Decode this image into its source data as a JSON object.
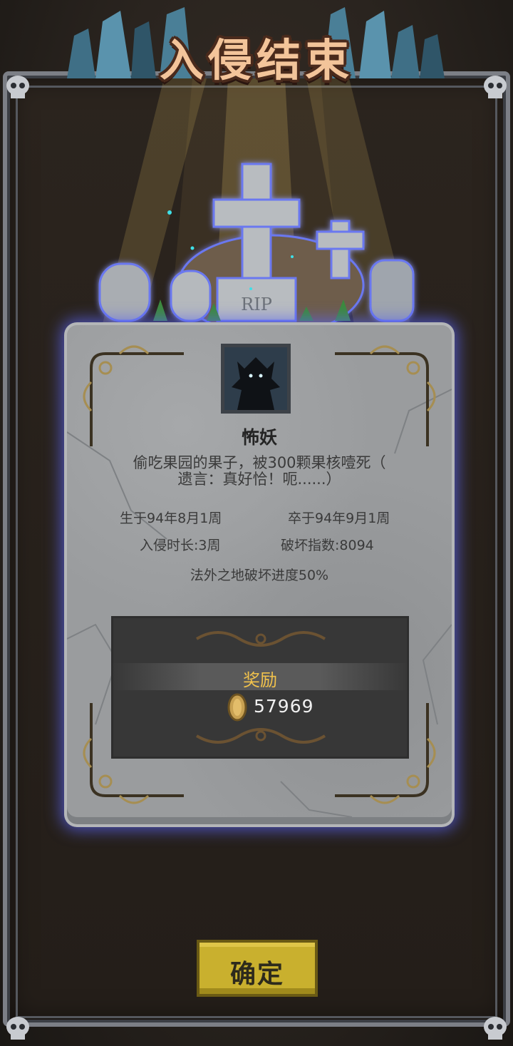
{
  "header": {
    "title": "入侵结束"
  },
  "graves": {
    "engraving": "RIP"
  },
  "monster": {
    "name": "怖妖",
    "epitaph_line1": "偷吃果园的果子，被300颗果核噎死（",
    "epitaph_line2": "遗言：真好恰！呃......）"
  },
  "stats": {
    "born": "生于94年8月1周",
    "died": "卒于94年9月1周",
    "duration": "入侵时长:3周",
    "destruction_index": "破坏指数:8094",
    "progress": "法外之地破坏进度50%"
  },
  "reward": {
    "title": "奖励",
    "amount": "57969",
    "currency_icon": "gold-coin-icon"
  },
  "buttons": {
    "confirm_label": "确定"
  },
  "colors": {
    "title": "#f3c49a",
    "reward_title": "#f1c24c",
    "button": "#c9b02e",
    "glow": "#5a64f0"
  }
}
